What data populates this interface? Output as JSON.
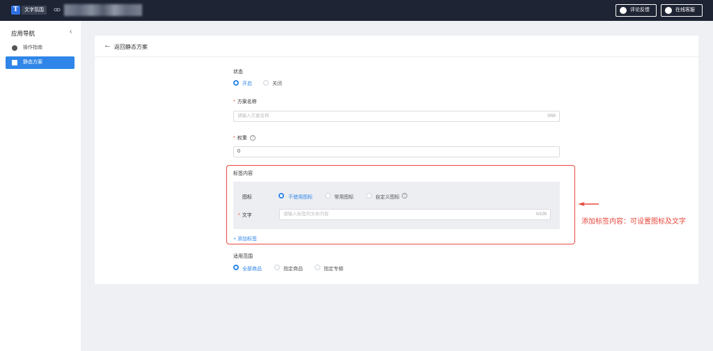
{
  "topbar": {
    "app_name": "文字氛围",
    "feedback_label": "评论反馈",
    "service_label": "在线客服"
  },
  "sidebar": {
    "title": "应用导航",
    "items": [
      {
        "label": "操作指南",
        "active": false
      },
      {
        "label": "静态方案",
        "active": true
      }
    ]
  },
  "header": {
    "back_label": "返回静态方案"
  },
  "form": {
    "status": {
      "label": "状态",
      "options": [
        "开启",
        "关闭"
      ],
      "selected": "开启"
    },
    "name": {
      "label": "方案名称",
      "placeholder": "请输入方案名称",
      "count": "0/50"
    },
    "weight": {
      "label": "权重",
      "value": "0"
    },
    "tag_content": {
      "label": "标签内容",
      "icon_label": "图标",
      "icon_options": [
        "不使用图标",
        "常用图标",
        "自定义图标"
      ],
      "icon_selected": "不使用图标",
      "text_label": "文字",
      "text_placeholder": "请输入标签的文本内容",
      "text_count": "0/100",
      "add_label": "添加标签"
    },
    "scope": {
      "label": "适用范围",
      "options": [
        "全部商品",
        "指定商品",
        "指定专辑"
      ],
      "selected": "全部商品"
    }
  },
  "annotation": {
    "text": "添加标签内容：可设置图标及文字",
    "color": "#e5483c"
  },
  "colors": {
    "accent": "#2f86e8",
    "topbar": "#1e2433",
    "annotation": "#e5483c"
  }
}
